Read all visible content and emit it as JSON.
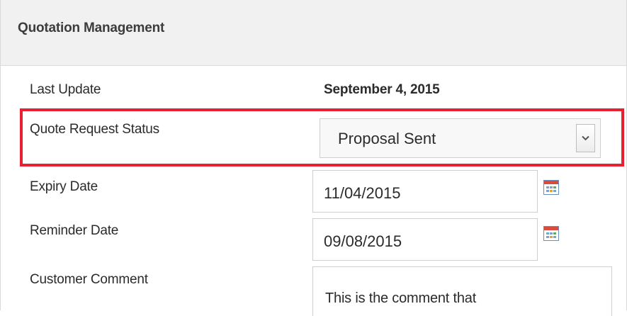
{
  "panel": {
    "title": "Quotation Management"
  },
  "form": {
    "last_update": {
      "label": "Last Update",
      "value": "September 4, 2015"
    },
    "quote_status": {
      "label": "Quote Request Status",
      "selected": "Proposal Sent"
    },
    "expiry_date": {
      "label": "Expiry Date",
      "value": "11/04/2015"
    },
    "reminder_date": {
      "label": "Reminder Date",
      "value": "09/08/2015"
    },
    "customer_comment": {
      "label": "Customer Comment",
      "value": "This is the comment that"
    }
  },
  "colors": {
    "highlight": "#e8202f",
    "header_bg": "#f1f1f1"
  },
  "icons": {
    "dropdown": "chevron-down-icon",
    "calendar": "calendar-icon"
  }
}
